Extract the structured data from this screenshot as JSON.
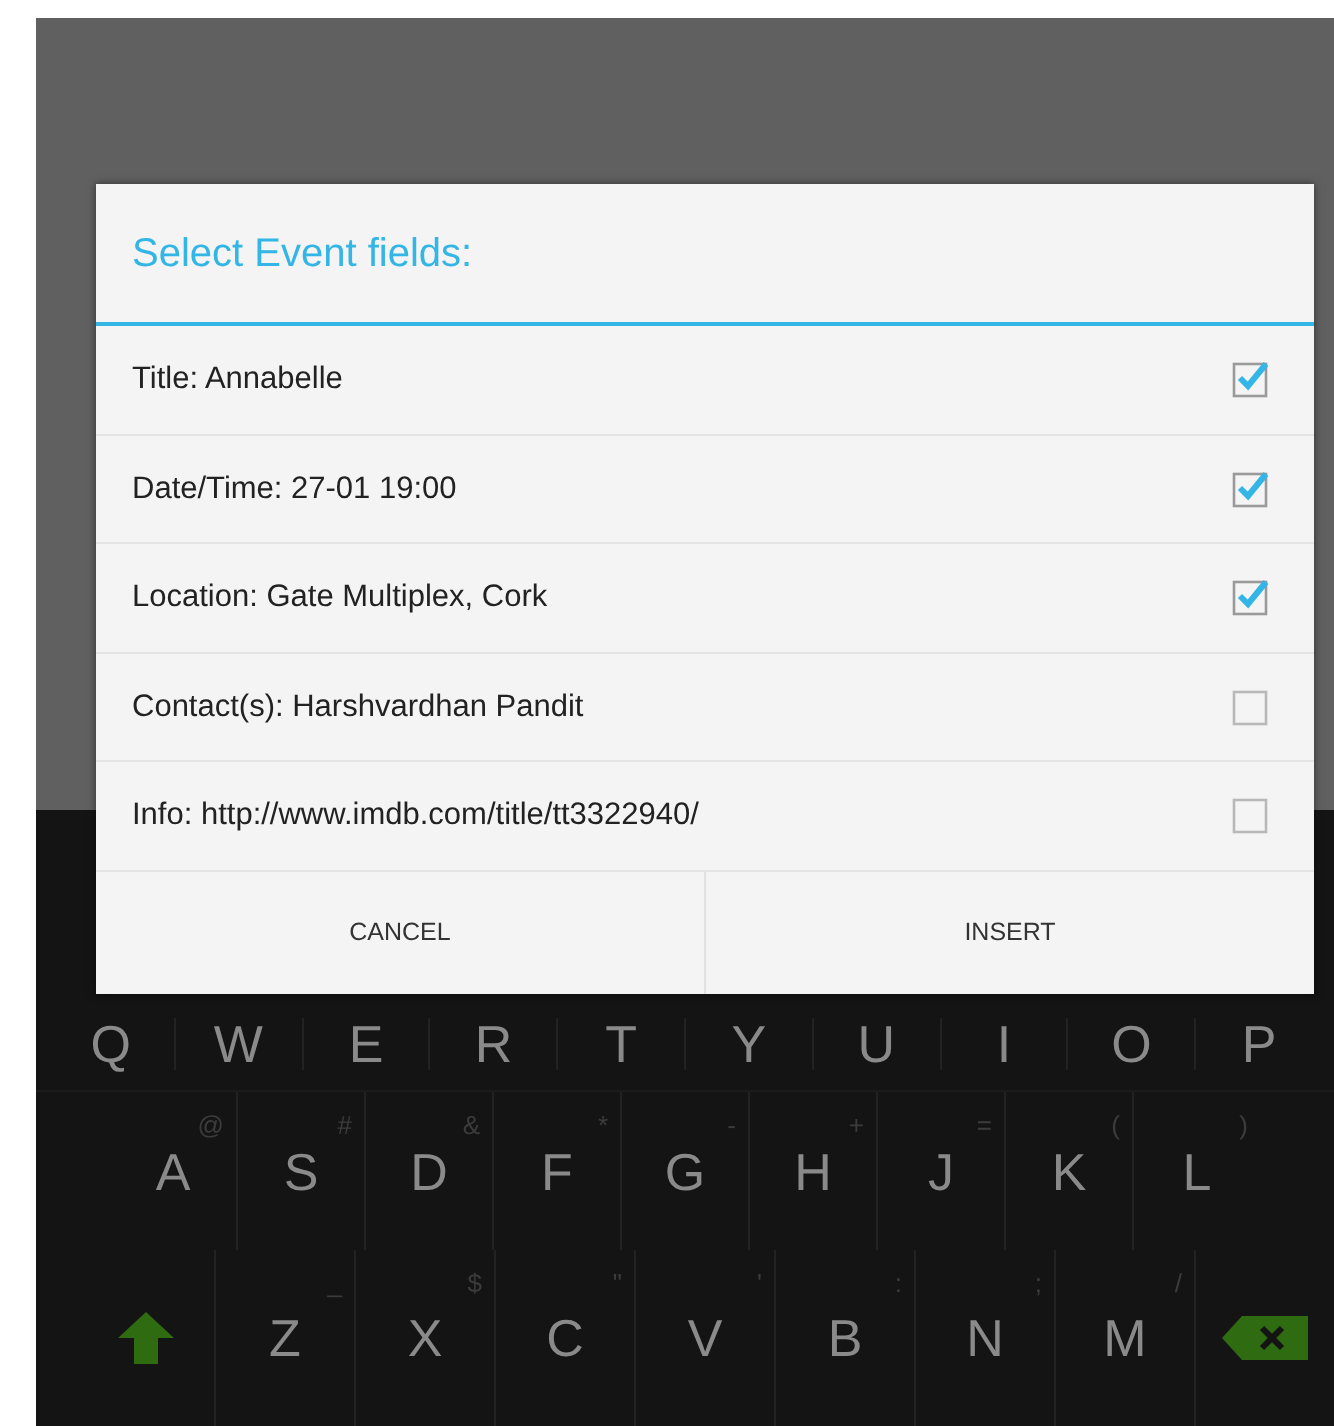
{
  "dialog": {
    "title": "Select Event fields:",
    "fields": [
      {
        "label": "Title: Annabelle",
        "checked": true
      },
      {
        "label": "Date/Time: 27-01 19:00",
        "checked": true
      },
      {
        "label": "Location: Gate Multiplex, Cork",
        "checked": true
      },
      {
        "label": "Contact(s): Harshvardhan Pandit",
        "checked": false
      },
      {
        "label": "Info: http://www.imdb.com/title/tt3322940/",
        "checked": false
      }
    ],
    "buttons": [
      "CANCEL",
      "INSERT"
    ]
  },
  "keyboard": {
    "rows": [
      [
        {
          "kind": "letter",
          "label": "Q"
        },
        {
          "kind": "letter",
          "label": "W"
        },
        {
          "kind": "letter",
          "label": "E"
        },
        {
          "kind": "letter",
          "label": "R"
        },
        {
          "kind": "letter",
          "label": "T"
        },
        {
          "kind": "letter",
          "label": "Y"
        },
        {
          "kind": "letter",
          "label": "U"
        },
        {
          "kind": "letter",
          "label": "I"
        },
        {
          "kind": "letter",
          "label": "O"
        },
        {
          "kind": "letter",
          "label": "P"
        }
      ],
      [
        {
          "kind": "letter",
          "label": "A",
          "hint": "@"
        },
        {
          "kind": "letter",
          "label": "S",
          "hint": "#"
        },
        {
          "kind": "letter",
          "label": "D",
          "hint": "&"
        },
        {
          "kind": "letter",
          "label": "F",
          "hint": "*"
        },
        {
          "kind": "letter",
          "label": "G",
          "hint": "-"
        },
        {
          "kind": "letter",
          "label": "H",
          "hint": "+"
        },
        {
          "kind": "letter",
          "label": "J",
          "hint": "="
        },
        {
          "kind": "letter",
          "label": "K",
          "hint": "("
        },
        {
          "kind": "letter",
          "label": "L",
          "hint": ")"
        }
      ],
      [
        {
          "kind": "shift"
        },
        {
          "kind": "letter",
          "label": "Z",
          "hint": "_"
        },
        {
          "kind": "letter",
          "label": "X",
          "hint": "$"
        },
        {
          "kind": "letter",
          "label": "C",
          "hint": "\""
        },
        {
          "kind": "letter",
          "label": "V",
          "hint": "'"
        },
        {
          "kind": "letter",
          "label": "B",
          "hint": ":"
        },
        {
          "kind": "letter",
          "label": "N",
          "hint": ";"
        },
        {
          "kind": "letter",
          "label": "M",
          "hint": "/"
        },
        {
          "kind": "backspace"
        }
      ]
    ]
  }
}
